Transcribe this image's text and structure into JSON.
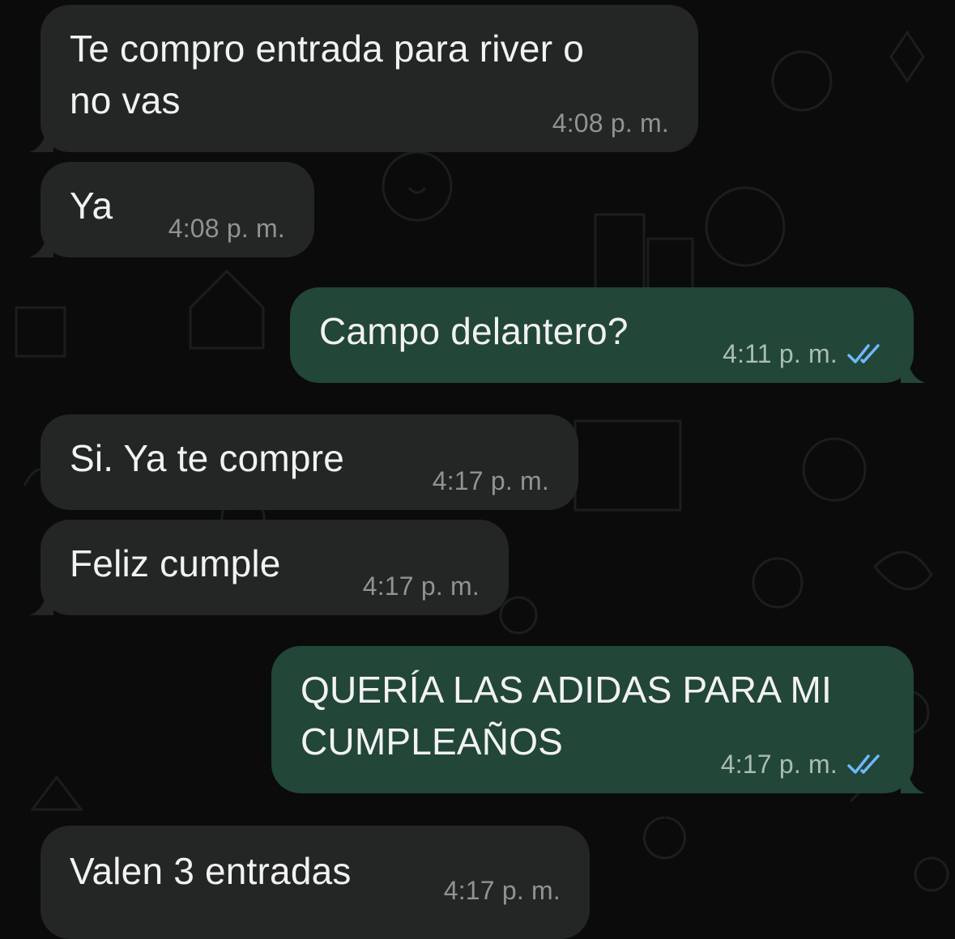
{
  "chat": {
    "messages": [
      {
        "direction": "incoming",
        "text": "Te compro entrada para river o\nno vas",
        "time": "4:08 p. m."
      },
      {
        "direction": "incoming",
        "text": "Ya",
        "time": "4:08 p. m."
      },
      {
        "direction": "outgoing",
        "text": "Campo delantero?",
        "time": "4:11 p. m.",
        "status": "read"
      },
      {
        "direction": "incoming",
        "text": "Si. Ya te compre",
        "time": "4:17 p. m."
      },
      {
        "direction": "incoming",
        "text": "Feliz cumple",
        "time": "4:17 p. m."
      },
      {
        "direction": "outgoing",
        "text": "QUERÍA LAS ADIDAS PARA MI\nCUMPLEAÑOS",
        "time": "4:17 p. m.",
        "status": "read"
      },
      {
        "direction": "incoming",
        "text": "Valen 3 entradas",
        "time": "4:17 p. m."
      }
    ]
  },
  "colors": {
    "background": "#0b0b0b",
    "incoming_bubble": "#242626",
    "outgoing_bubble": "#224638",
    "read_ticks": "#6fb8ff",
    "timestamp": "#8f9393"
  }
}
